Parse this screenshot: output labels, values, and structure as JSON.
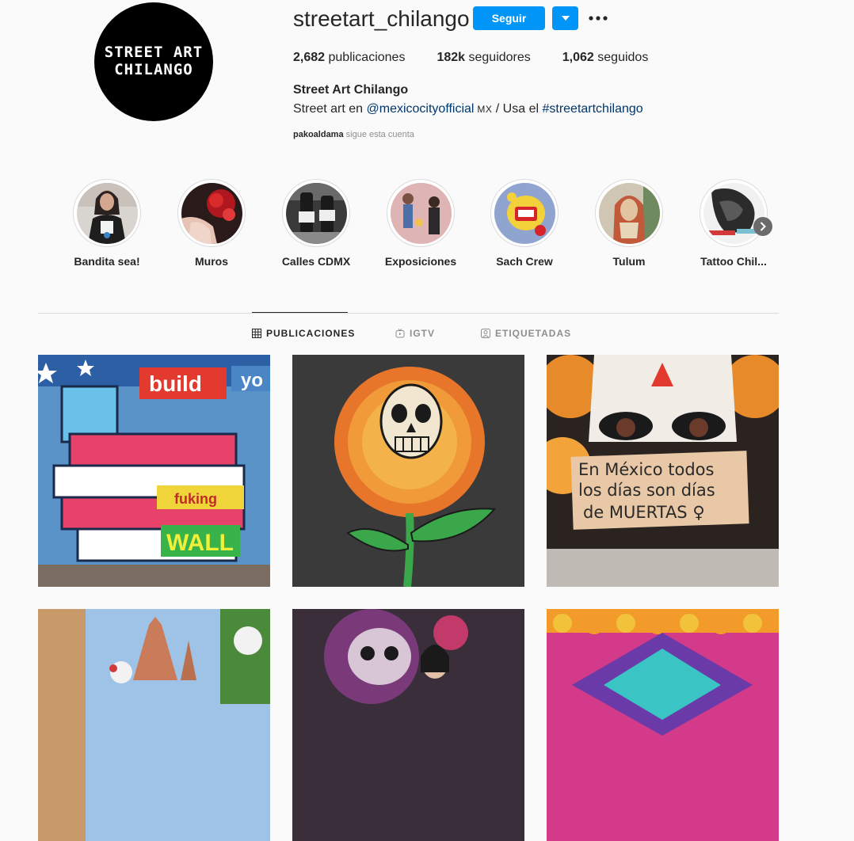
{
  "profile": {
    "avatar_line1": "STREET ART",
    "avatar_line2": "CHILANGO",
    "username": "streetart_chilango",
    "follow_label": "Seguir",
    "posts_count": "2,682",
    "posts_label": "publicaciones",
    "followers_count": "182k",
    "followers_label": "seguidores",
    "following_count": "1,062",
    "following_label": "seguidos",
    "full_name": "Street Art Chilango",
    "bio_prefix": "Street art en ",
    "bio_mention": "@mexicocityofficial",
    "bio_flag": " MX",
    "bio_middle": " / Usa el ",
    "bio_hashtag": "#streetartchilango",
    "followed_by_user": "pakoaldama",
    "followed_by_text": " sigue esta cuenta"
  },
  "highlights": [
    {
      "label": "Bandita sea!"
    },
    {
      "label": "Muros"
    },
    {
      "label": "Calles CDMX"
    },
    {
      "label": "Exposiciones"
    },
    {
      "label": "Sach Crew"
    },
    {
      "label": "Tulum"
    },
    {
      "label": "Tattoo Chil..."
    }
  ],
  "tabs": {
    "posts": "PUBLICACIONES",
    "igtv": "IGTV",
    "tagged": "ETIQUETADAS"
  },
  "posts": {
    "p1_text1": "build",
    "p1_text2": "yo",
    "p1_text3": "fuking",
    "p1_text4": "WALL",
    "p3_text1": "En México todos",
    "p3_text2": "los días son días",
    "p3_text3": "de MUERTAS ♀"
  },
  "colors": {
    "accent": "#0095f6",
    "link": "#00376b",
    "muted": "#8e8e8e",
    "border": "#dbdbdb"
  }
}
